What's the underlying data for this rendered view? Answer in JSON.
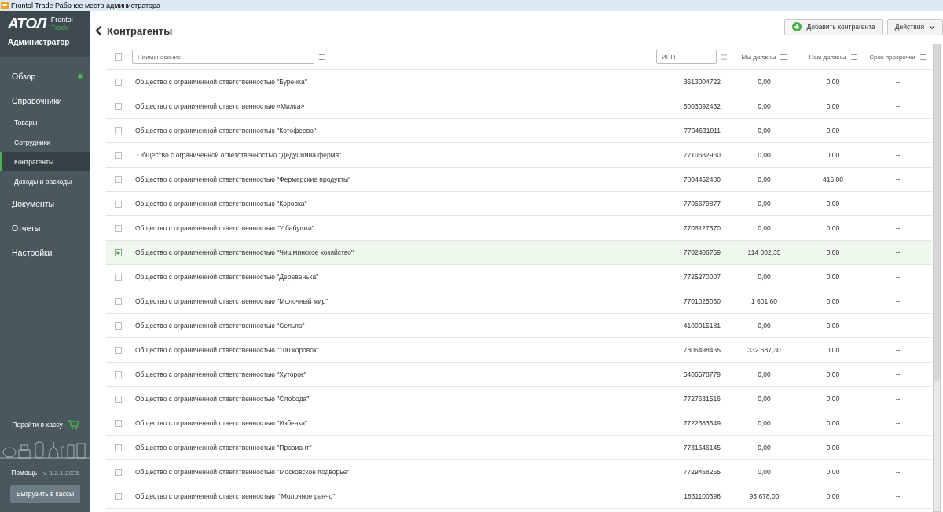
{
  "window": {
    "title": "Frontol Trade Рабочее место администратора"
  },
  "sidebar": {
    "logo": "АТОЛ",
    "product": "Frontol",
    "edition": "Trade",
    "user": "Администратор",
    "items": [
      {
        "kind": "group",
        "label": "Обзор",
        "selected": false,
        "status_dot": true
      },
      {
        "kind": "group",
        "label": "Справочники",
        "selected": false,
        "status_dot": false
      },
      {
        "kind": "sub",
        "label": "Товары",
        "selected": false,
        "status_dot": false
      },
      {
        "kind": "sub",
        "label": "Сотрудники",
        "selected": false,
        "status_dot": false
      },
      {
        "kind": "sub",
        "label": "Контрагенты",
        "selected": true,
        "status_dot": false
      },
      {
        "kind": "sub",
        "label": "Доходы и расходы",
        "selected": false,
        "status_dot": false
      },
      {
        "kind": "group",
        "label": "Документы",
        "selected": false,
        "status_dot": false
      },
      {
        "kind": "group",
        "label": "Отчеты",
        "selected": false,
        "status_dot": false
      },
      {
        "kind": "group",
        "label": "Настройки",
        "selected": false,
        "status_dot": false
      }
    ],
    "pos_link": "Перейти в кассу",
    "help": "Помощь",
    "version": "v. 1.2.1.2035",
    "upload_button": "Выгрузить в кассы"
  },
  "page": {
    "title": "Контрагенты",
    "add_button": "Добавить контрагента",
    "actions_button": "Действия"
  },
  "table": {
    "select_all": false,
    "columns": [
      {
        "kind": "filter",
        "placeholder": "Наименование"
      },
      {
        "kind": "filter",
        "placeholder": "ИНН"
      },
      {
        "kind": "label",
        "label": "Мы должны"
      },
      {
        "kind": "label",
        "label": "Нам должны"
      },
      {
        "kind": "label",
        "label": "Срок просрочки"
      }
    ],
    "rows": [
      {
        "name": "Общество с ограниченной ответственностью \"Буренка\"",
        "inn": "3613004722",
        "we_owe": "0,00",
        "they_owe": "0,00",
        "overdue": "--",
        "selected": false
      },
      {
        "name": "Общество с ограниченной ответственностью «Милка»",
        "inn": "5003092432",
        "we_owe": "0,00",
        "they_owe": "0,00",
        "overdue": "--",
        "selected": false
      },
      {
        "name": "Общество с ограниченной ответственностью \"Котофеево\"",
        "inn": "7704631911",
        "we_owe": "0,00",
        "they_owe": "0,00",
        "overdue": "--",
        "selected": false
      },
      {
        "name": " Общество с ограниченной ответственностью \"Дедушкина ферма\"",
        "inn": "7710682960",
        "we_owe": "0,00",
        "they_owe": "0,00",
        "overdue": "--",
        "selected": false
      },
      {
        "name": "Общество с ограниченной ответственностью \"Фермерские продукты\"",
        "inn": "7804452480",
        "we_owe": "0,00",
        "they_owe": "415,00",
        "overdue": "--",
        "selected": false
      },
      {
        "name": "Общество с ограниченной ответственностью \"Коровка\"",
        "inn": "7706679877",
        "we_owe": "0,00",
        "they_owe": "0,00",
        "overdue": "--",
        "selected": false
      },
      {
        "name": "Общество с ограниченной ответственностью \"У бабушки\"",
        "inn": "7706127570",
        "we_owe": "0,00",
        "they_owe": "0,00",
        "overdue": "--",
        "selected": false
      },
      {
        "name": "Общество с ограниченной ответственностью \"Чишминское хозяйство\"",
        "inn": "7702406759",
        "we_owe": "114 002,35",
        "they_owe": "0,00",
        "overdue": "--",
        "selected": true
      },
      {
        "name": "Общество с ограниченной ответственностью \"Деревенька\"",
        "inn": "7725270007",
        "we_owe": "0,00",
        "they_owe": "0,00",
        "overdue": "--",
        "selected": false
      },
      {
        "name": "Общество с ограниченной ответственностью \"Молочный мир\"",
        "inn": "7701025060",
        "we_owe": "1 601,60",
        "they_owe": "0,00",
        "overdue": "--",
        "selected": false
      },
      {
        "name": "Общество с ограниченной ответственностью \"Сельпо\"",
        "inn": "4100015181",
        "we_owe": "0,00",
        "they_owe": "0,00",
        "overdue": "--",
        "selected": false
      },
      {
        "name": "Общество с ограниченной ответственностью \"100 коровок\"",
        "inn": "7806498465",
        "we_owe": "332 687,30",
        "they_owe": "0,00",
        "overdue": "--",
        "selected": false
      },
      {
        "name": "Общество с ограниченной ответственностью \"Хуторок\"",
        "inn": "5406578779",
        "we_owe": "0,00",
        "they_owe": "0,00",
        "overdue": "--",
        "selected": false
      },
      {
        "name": "Общество с ограниченной ответственностью \"Слобода\"",
        "inn": "7727631516",
        "we_owe": "0,00",
        "they_owe": "0,00",
        "overdue": "--",
        "selected": false
      },
      {
        "name": "Общество с ограниченной ответственностью \"Избенка\"",
        "inn": "7722383549",
        "we_owe": "0,00",
        "they_owe": "0,00",
        "overdue": "--",
        "selected": false
      },
      {
        "name": "Общество с ограниченной ответственностью \"Провиант\"",
        "inn": "7731646145",
        "we_owe": "0,00",
        "they_owe": "0,00",
        "overdue": "--",
        "selected": false
      },
      {
        "name": "Общество с ограниченной ответственностью \"Московское подворье\"",
        "inn": "7729468255",
        "we_owe": "0,00",
        "they_owe": "0,00",
        "overdue": "--",
        "selected": false
      },
      {
        "name": "Общество с ограниченной ответственностью  \"Молочное ранчо\"",
        "inn": "1831100398",
        "we_owe": "93 678,00",
        "they_owe": "0,00",
        "overdue": "--",
        "selected": false
      }
    ]
  }
}
